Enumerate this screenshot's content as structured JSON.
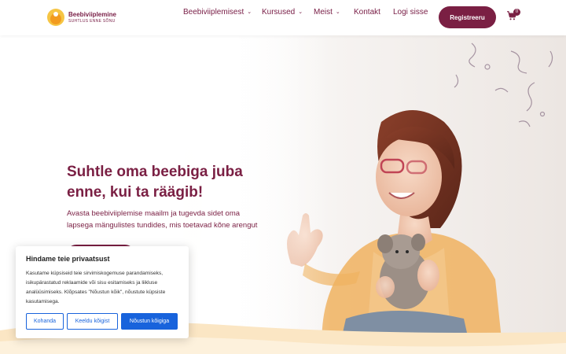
{
  "header": {
    "logo": {
      "title": "Beebiviiplemine",
      "tagline": "SUHTLUS ENNE SÕNU"
    },
    "nav": [
      {
        "label": "Beebiviiplemisest",
        "has_dropdown": true
      },
      {
        "label": "Kursused",
        "has_dropdown": true
      },
      {
        "label": "Meist",
        "has_dropdown": true
      },
      {
        "label": "Kontakt",
        "has_dropdown": false
      },
      {
        "label": "Logi sisse",
        "has_dropdown": false
      }
    ],
    "register_label": "Registreeru",
    "cart_count": "0",
    "chevron_glyph": "⌄"
  },
  "hero": {
    "title": "Suhtle oma beebiga juba enne, kui ta räägib!",
    "subtitle": "Avasta beebiviiplemise maailm ja tugevda sidet oma lapsega mängulistes tundides, mis toetavad kõne arengut"
  },
  "cookie": {
    "title": "Hindame teie privaatsust",
    "text": "Kasutame küpsiseid teie sirvimiskogemuse parandamiseks, isikupärastatud reklaamide või sisu esitamiseks ja liikluse analüüsimiseks. Klõpsates \"Nõustun kõik\", nõustute küpsiste kasutamisega.",
    "buttons": {
      "customize": "Kohanda",
      "reject": "Keeldu kõigist",
      "accept": "Nõustun kõigiga"
    }
  },
  "colors": {
    "brand": "#7a1f43",
    "accent_blue": "#1863dc",
    "logo_yellow": "#f6c544"
  }
}
